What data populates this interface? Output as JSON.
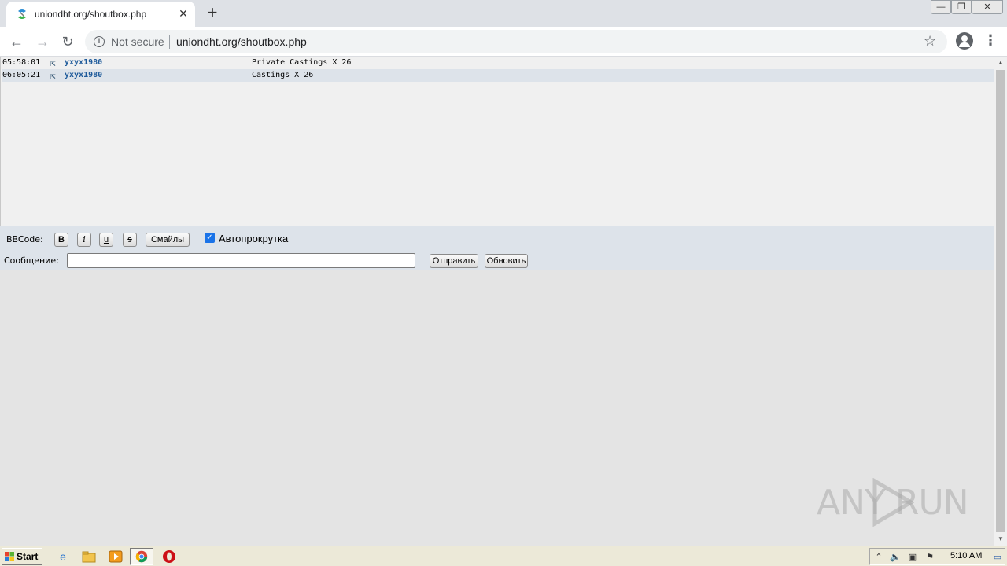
{
  "browser": {
    "tab_title": "uniondht.org/shoutbox.php",
    "tab_close": "✕",
    "new_tab": "+",
    "security_label": "Not secure",
    "url": "uniondht.org/shoutbox.php",
    "window_controls": {
      "minimize": "—",
      "maximize": "❐",
      "close": "✕"
    }
  },
  "shoutbox": {
    "messages": [
      {
        "time": "05:58:01",
        "user": "yxyx1980",
        "text": "Private Castings X 26"
      },
      {
        "time": "06:05:21",
        "user": "yxyx1980",
        "text": "Castings X 26"
      }
    ],
    "bbcode_label": "BBCode:",
    "bbcode_buttons": {
      "bold": "B",
      "italic": "i",
      "underline": "u",
      "strike": "s"
    },
    "smiles_label": "Смайлы",
    "autoscroll_label": "Автопрокрутка",
    "autoscroll_checked": true,
    "message_label": "Сообщение:",
    "message_value": "",
    "send_label": "Отправить",
    "refresh_label": "Обновить"
  },
  "watermark": {
    "text": "ANY  RUN"
  },
  "taskbar": {
    "start_label": "Start",
    "clock": "5:10 AM"
  },
  "colors": {
    "accent": "#1a73e8",
    "username": "#1f5b9b",
    "alt_row": "#dde3ea"
  }
}
